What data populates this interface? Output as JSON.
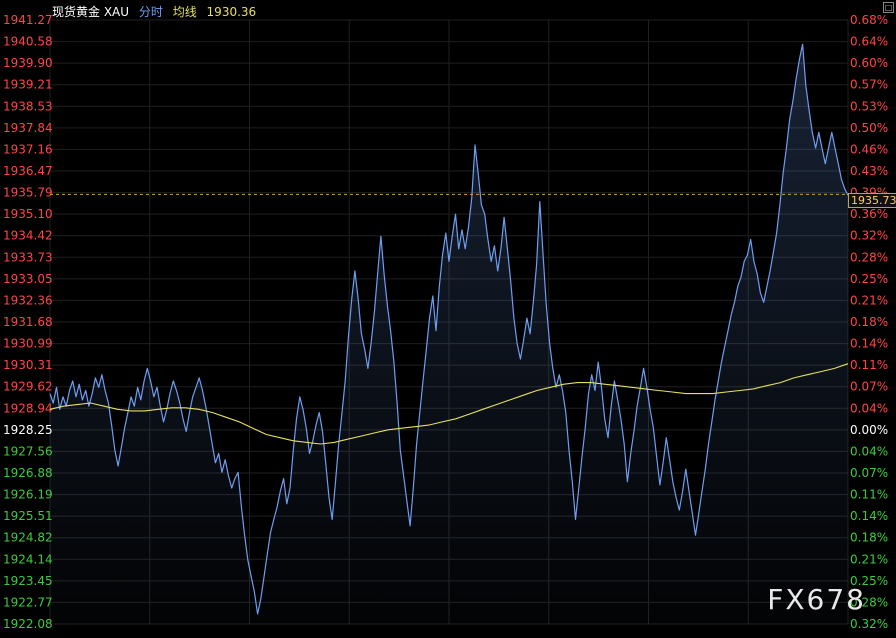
{
  "header": {
    "instrument": "现货黄金 XAU",
    "mode": "分时",
    "avg_label": "均线",
    "avg_value": "1930.36"
  },
  "watermark": "FX678",
  "corner_button": "□",
  "colors": {
    "background": "#000000",
    "price_line": "#6e9ef0",
    "avg_line": "#e6e05a",
    "up": "#ff4545",
    "down": "#3dcc3d",
    "neutral": "#ffffff",
    "grid": "#1f1f1f",
    "ref_line": "#d89a3a"
  },
  "chart_data": {
    "type": "line",
    "title": "",
    "xlabel": "",
    "ylabel": "",
    "ylim": [
      1922.08,
      1941.27
    ],
    "reference_price": 1928.25,
    "current_price": 1935.73,
    "current_price_label": "1935.73",
    "left_ticks": [
      "1941.27",
      "1940.58",
      "1939.90",
      "1939.21",
      "1938.53",
      "1937.84",
      "1937.16",
      "1936.47",
      "1935.79",
      "1935.10",
      "1934.42",
      "1933.73",
      "1933.05",
      "1932.36",
      "1931.68",
      "1930.99",
      "1930.31",
      "1929.62",
      "1928.94",
      "1928.25",
      "1927.56",
      "1926.88",
      "1926.19",
      "1925.51",
      "1924.82",
      "1924.14",
      "1923.45",
      "1922.77",
      "1922.08"
    ],
    "right_ticks": [
      "0.68%",
      "0.64%",
      "0.60%",
      "0.57%",
      "0.53%",
      "0.50%",
      "0.46%",
      "0.43%",
      "0.39%",
      "0.36%",
      "0.32%",
      "0.28%",
      "0.25%",
      "0.21%",
      "0.18%",
      "0.14%",
      "0.11%",
      "0.07%",
      "0.04%",
      "0.00%",
      "0.04%",
      "0.07%",
      "0.11%",
      "0.14%",
      "0.18%",
      "0.21%",
      "0.25%",
      "0.28%",
      "0.32%"
    ],
    "grid": true,
    "series": [
      {
        "values": [
          1929.4,
          1929.1,
          1929.6,
          1928.9,
          1929.3,
          1929.0,
          1929.5,
          1929.8,
          1929.3,
          1929.7,
          1929.2,
          1929.5,
          1929.0,
          1929.4,
          1929.9,
          1929.6,
          1930.0,
          1929.5,
          1929.1,
          1928.4,
          1927.6,
          1927.1,
          1927.7,
          1928.3,
          1928.8,
          1929.3,
          1929.0,
          1929.6,
          1929.2,
          1929.8,
          1930.2,
          1929.8,
          1929.3,
          1929.6,
          1929.0,
          1928.5,
          1928.9,
          1929.4,
          1929.8,
          1929.5,
          1929.1,
          1928.6,
          1928.2,
          1928.8,
          1929.3,
          1929.6,
          1929.9,
          1929.5,
          1929.0,
          1928.4,
          1927.8,
          1927.2,
          1927.5,
          1926.9,
          1927.3,
          1926.8,
          1926.4,
          1926.7,
          1926.9,
          1925.8,
          1924.9,
          1924.1,
          1923.6,
          1923.1,
          1922.4,
          1922.9,
          1923.6,
          1924.3,
          1925.0,
          1925.4,
          1925.8,
          1926.3,
          1926.7,
          1925.9,
          1926.4,
          1927.6,
          1928.6,
          1929.3,
          1928.9,
          1928.3,
          1927.5,
          1927.9,
          1928.4,
          1928.8,
          1928.2,
          1927.2,
          1926.1,
          1925.4,
          1926.6,
          1927.8,
          1928.8,
          1929.8,
          1931.2,
          1932.4,
          1933.3,
          1932.4,
          1931.3,
          1930.8,
          1930.2,
          1931.0,
          1932.0,
          1933.2,
          1934.4,
          1933.2,
          1932.2,
          1931.4,
          1930.4,
          1929.1,
          1927.6,
          1926.8,
          1926.0,
          1925.2,
          1926.4,
          1927.8,
          1928.8,
          1929.8,
          1930.8,
          1931.8,
          1932.5,
          1931.4,
          1932.8,
          1933.8,
          1934.5,
          1933.6,
          1934.4,
          1935.1,
          1934.0,
          1934.6,
          1934.0,
          1934.7,
          1935.6,
          1937.3,
          1936.4,
          1935.4,
          1935.1,
          1934.3,
          1933.6,
          1934.1,
          1933.3,
          1934.0,
          1935.0,
          1934.0,
          1933.0,
          1931.8,
          1931.0,
          1930.5,
          1931.1,
          1931.8,
          1931.3,
          1932.3,
          1933.5,
          1935.5,
          1933.8,
          1932.2,
          1931.0,
          1930.2,
          1929.6,
          1930.0,
          1929.5,
          1928.8,
          1927.6,
          1926.6,
          1925.4,
          1926.4,
          1927.4,
          1928.3,
          1929.4,
          1930.0,
          1929.5,
          1930.4,
          1929.6,
          1928.6,
          1928.0,
          1929.0,
          1929.8,
          1929.2,
          1928.6,
          1927.8,
          1926.6,
          1927.5,
          1928.2,
          1929.0,
          1929.6,
          1930.2,
          1929.6,
          1928.9,
          1928.3,
          1927.4,
          1926.5,
          1927.2,
          1928.0,
          1927.3,
          1926.6,
          1926.1,
          1925.7,
          1926.3,
          1927.0,
          1926.3,
          1925.6,
          1924.9,
          1925.6,
          1926.3,
          1927.0,
          1927.8,
          1928.5,
          1929.2,
          1929.8,
          1930.4,
          1930.9,
          1931.4,
          1931.9,
          1932.3,
          1932.8,
          1933.1,
          1933.6,
          1933.8,
          1934.3,
          1933.6,
          1933.2,
          1932.6,
          1932.3,
          1932.8,
          1933.3,
          1933.9,
          1934.5,
          1935.4,
          1936.4,
          1937.2,
          1938.1,
          1938.7,
          1939.4,
          1940.0,
          1940.5,
          1939.2,
          1938.4,
          1937.7,
          1937.2,
          1937.7,
          1937.2,
          1936.7,
          1937.2,
          1937.7,
          1937.2,
          1936.7,
          1936.2,
          1935.9,
          1935.7
        ]
      },
      {
        "name": "均线",
        "values": [
          1928.9,
          1929.0,
          1929.05,
          1929.1,
          1929.0,
          1928.9,
          1928.85,
          1928.85,
          1928.9,
          1928.95,
          1928.95,
          1928.9,
          1928.8,
          1928.65,
          1928.5,
          1928.3,
          1928.1,
          1928.0,
          1927.9,
          1927.85,
          1927.8,
          1927.85,
          1927.95,
          1928.05,
          1928.15,
          1928.25,
          1928.3,
          1928.35,
          1928.4,
          1928.5,
          1928.6,
          1928.75,
          1928.9,
          1929.05,
          1929.2,
          1929.35,
          1929.5,
          1929.6,
          1929.7,
          1929.75,
          1929.75,
          1929.7,
          1929.65,
          1929.6,
          1929.55,
          1929.5,
          1929.45,
          1929.4,
          1929.4,
          1929.4,
          1929.45,
          1929.5,
          1929.55,
          1929.65,
          1929.75,
          1929.9,
          1930.0,
          1930.1,
          1930.2,
          1930.35
        ]
      }
    ]
  }
}
